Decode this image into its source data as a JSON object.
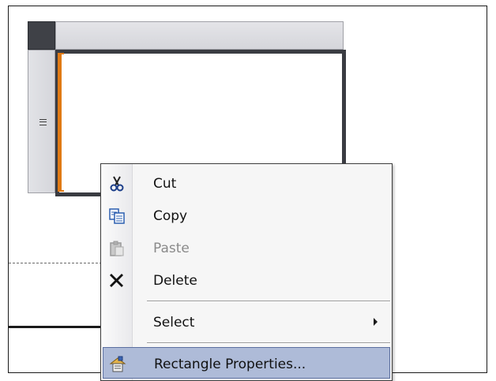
{
  "canvas": {
    "group_glyph": "group-lines-icon"
  },
  "context_menu": {
    "items": [
      {
        "label": "Cut",
        "icon": "scissors-icon",
        "enabled": true
      },
      {
        "label": "Copy",
        "icon": "copy-icon",
        "enabled": true
      },
      {
        "label": "Paste",
        "icon": "paste-icon",
        "enabled": false
      },
      {
        "label": "Delete",
        "icon": "delete-x-icon",
        "enabled": true
      },
      {
        "label": "Select",
        "icon": "",
        "enabled": true,
        "has_submenu": true
      },
      {
        "label": "Rectangle Properties...",
        "icon": "properties-icon",
        "enabled": true,
        "highlighted": true
      }
    ]
  },
  "colors": {
    "selection_border": "#3a3c42",
    "selection_accent": "#e07a14",
    "menu_highlight": "#aebbd8"
  }
}
